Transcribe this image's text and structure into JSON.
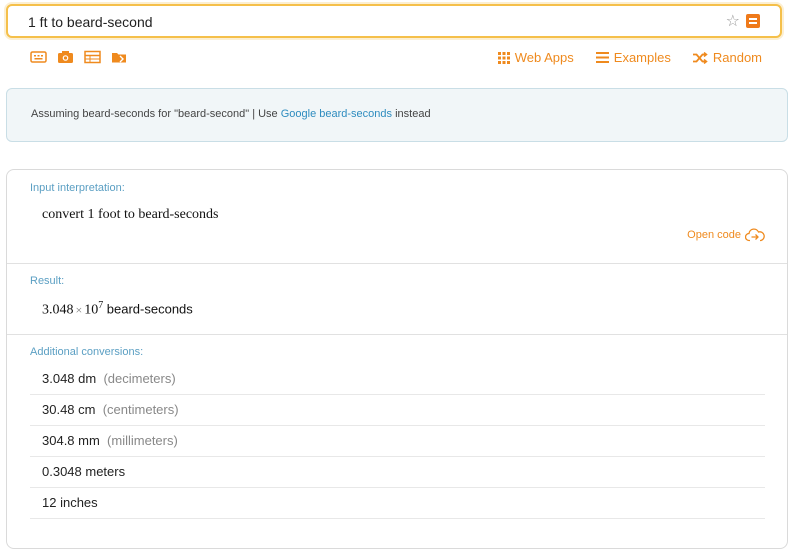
{
  "search": {
    "value": "1 ft to beard-second"
  },
  "toolbar": {
    "links": [
      {
        "label": "Web Apps",
        "icon": "grid-icon"
      },
      {
        "label": "Examples",
        "icon": "list-icon"
      },
      {
        "label": "Random",
        "icon": "shuffle-icon"
      }
    ]
  },
  "assumption": {
    "prefix": "Assuming beard-seconds for \"beard-second\" | Use ",
    "link": "Google beard-seconds",
    "suffix": " instead"
  },
  "pods": {
    "input": {
      "title": "Input interpretation:",
      "text": "convert 1 foot to beard-seconds",
      "open_code": "Open code"
    },
    "result": {
      "title": "Result:",
      "mantissa": "3.048",
      "times": "×",
      "base": "10",
      "exponent": "7",
      "unit": "beard-seconds"
    },
    "conversions": {
      "title": "Additional conversions:",
      "rows": [
        {
          "value": "3.048 dm",
          "unit": "(decimeters)"
        },
        {
          "value": "30.48 cm",
          "unit": "(centimeters)"
        },
        {
          "value": "304.8 mm",
          "unit": "(millimeters)"
        },
        {
          "value": "0.3048 meters",
          "unit": ""
        },
        {
          "value": "12 inches",
          "unit": ""
        }
      ]
    }
  },
  "colors": {
    "accent": "#ef8a1e",
    "link": "#2e8cbf",
    "pod_title": "#5b9fc3"
  }
}
